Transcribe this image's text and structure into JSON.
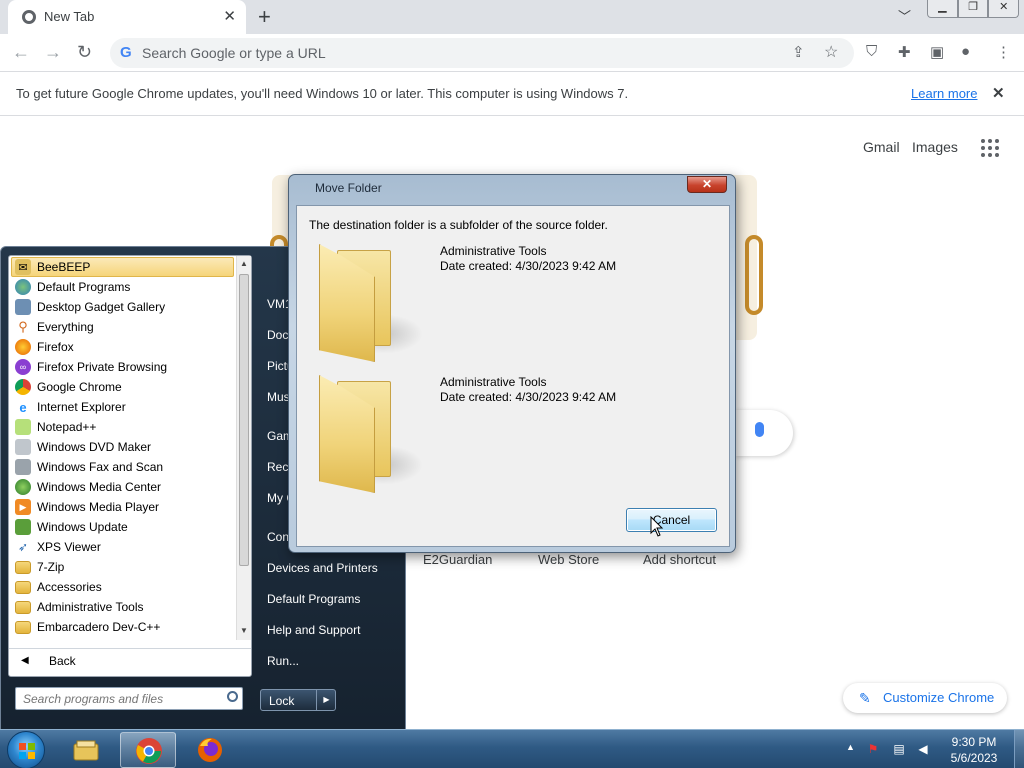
{
  "browser": {
    "tab_title": "New Tab",
    "omnibox_placeholder": "Search Google or type a URL",
    "infobar_message": "To get future Google Chrome updates, you'll need Windows 10 or later. This computer is using Windows 7.",
    "infobar_link": "Learn more",
    "top_links": {
      "gmail": "Gmail",
      "images": "Images"
    },
    "shortcuts": [
      "E2Guardian",
      "Web Store",
      "Add shortcut"
    ],
    "customize_label": "Customize Chrome"
  },
  "start_menu": {
    "programs": [
      {
        "label": "BeeBEEP",
        "icon": "beebeep-icon",
        "selected": true
      },
      {
        "label": "Default Programs",
        "icon": "default-programs-icon"
      },
      {
        "label": "Desktop Gadget Gallery",
        "icon": "gadget-gallery-icon"
      },
      {
        "label": "Everything",
        "icon": "everything-icon"
      },
      {
        "label": "Firefox",
        "icon": "firefox-icon"
      },
      {
        "label": "Firefox Private Browsing",
        "icon": "firefox-private-icon"
      },
      {
        "label": "Google Chrome",
        "icon": "chrome-icon"
      },
      {
        "label": "Internet Explorer",
        "icon": "internet-explorer-icon"
      },
      {
        "label": "Notepad++",
        "icon": "notepadpp-icon"
      },
      {
        "label": "Windows DVD Maker",
        "icon": "dvd-maker-icon"
      },
      {
        "label": "Windows Fax and Scan",
        "icon": "fax-scan-icon"
      },
      {
        "label": "Windows Media Center",
        "icon": "media-center-icon"
      },
      {
        "label": "Windows Media Player",
        "icon": "media-player-icon"
      },
      {
        "label": "Windows Update",
        "icon": "windows-update-icon"
      },
      {
        "label": "XPS Viewer",
        "icon": "xps-viewer-icon"
      },
      {
        "label": "7-Zip",
        "icon": "folder-icon"
      },
      {
        "label": "Accessories",
        "icon": "folder-icon"
      },
      {
        "label": "Administrative Tools",
        "icon": "folder-icon"
      },
      {
        "label": "Embarcadero Dev-C++",
        "icon": "folder-icon"
      }
    ],
    "back_label": "Back",
    "search_placeholder": "Search programs and files",
    "right_items": [
      "VM1",
      "Docu",
      "Pictu",
      "Musi",
      "Game",
      "Rece",
      "My C",
      "Cont",
      "Devices and Printers",
      "Default Programs",
      "Help and Support",
      "Run..."
    ],
    "lock_label": "Lock"
  },
  "dialog": {
    "title": "Move Folder",
    "message": "The destination folder is a subfolder of the source folder.",
    "items": [
      {
        "name": "Administrative Tools",
        "date": "Date created: 4/30/2023 9:42 AM"
      },
      {
        "name": "Administrative Tools",
        "date": "Date created: 4/30/2023 9:42 AM"
      }
    ],
    "cancel_label": "Cancel"
  },
  "taskbar": {
    "apps": [
      {
        "name": "file-explorer-icon",
        "active": false
      },
      {
        "name": "chrome-icon",
        "active": true
      },
      {
        "name": "firefox-icon",
        "active": false
      }
    ],
    "time": "9:30 PM",
    "date": "5/6/2023"
  }
}
